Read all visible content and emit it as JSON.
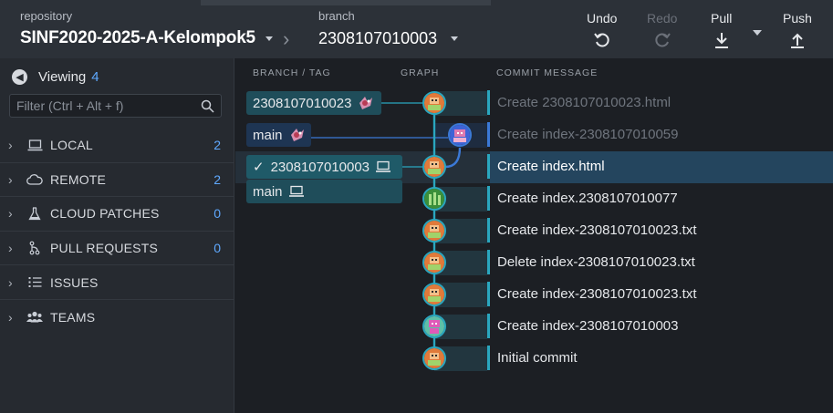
{
  "header": {
    "repo_label": "repository",
    "repo_name": "SINF2020-2025-A-Kelompok5",
    "branch_label": "branch",
    "branch_name": "2308107010003",
    "undo": "Undo",
    "redo": "Redo",
    "pull": "Pull",
    "push": "Push"
  },
  "sidebar": {
    "viewing_label": "Viewing",
    "viewing_count": "4",
    "filter_placeholder": "Filter (Ctrl + Alt + f)",
    "sections": [
      {
        "label": "LOCAL",
        "count": "2",
        "icon": "laptop-icon"
      },
      {
        "label": "REMOTE",
        "count": "2",
        "icon": "cloud-icon"
      },
      {
        "label": "CLOUD PATCHES",
        "count": "0",
        "icon": "flask-icon"
      },
      {
        "label": "PULL REQUESTS",
        "count": "0",
        "icon": "pull-request-icon"
      },
      {
        "label": "ISSUES",
        "count": "",
        "icon": "list-icon"
      },
      {
        "label": "TEAMS",
        "count": "",
        "icon": "team-icon"
      }
    ]
  },
  "columns": {
    "branch_tag": "BRANCH / TAG",
    "graph": "GRAPH",
    "commit_message": "COMMIT MESSAGE"
  },
  "refs": {
    "remote_branch": "2308107010023",
    "remote_main": "main",
    "local_current": "2308107010003",
    "local_main": "main"
  },
  "commits": [
    {
      "message": "Create 2308107010023.html",
      "dimmed": true
    },
    {
      "message": "Create index-2308107010059",
      "dimmed": true
    },
    {
      "message": "Create index.html",
      "dimmed": false,
      "selected": true
    },
    {
      "message": "Create index.2308107010077",
      "dimmed": false
    },
    {
      "message": "Create index-2308107010023.txt",
      "dimmed": false
    },
    {
      "message": "Delete index-2308107010023.txt",
      "dimmed": false
    },
    {
      "message": "Create index-2308107010023.txt",
      "dimmed": false
    },
    {
      "message": "Create index-2308107010003",
      "dimmed": false
    },
    {
      "message": "Initial commit",
      "dimmed": false
    }
  ],
  "colors": {
    "graph_line": "#2aa7bf",
    "branch_line": "#3b79d6",
    "selected_row": "#24455e",
    "accent_count": "#5fa9ff"
  }
}
